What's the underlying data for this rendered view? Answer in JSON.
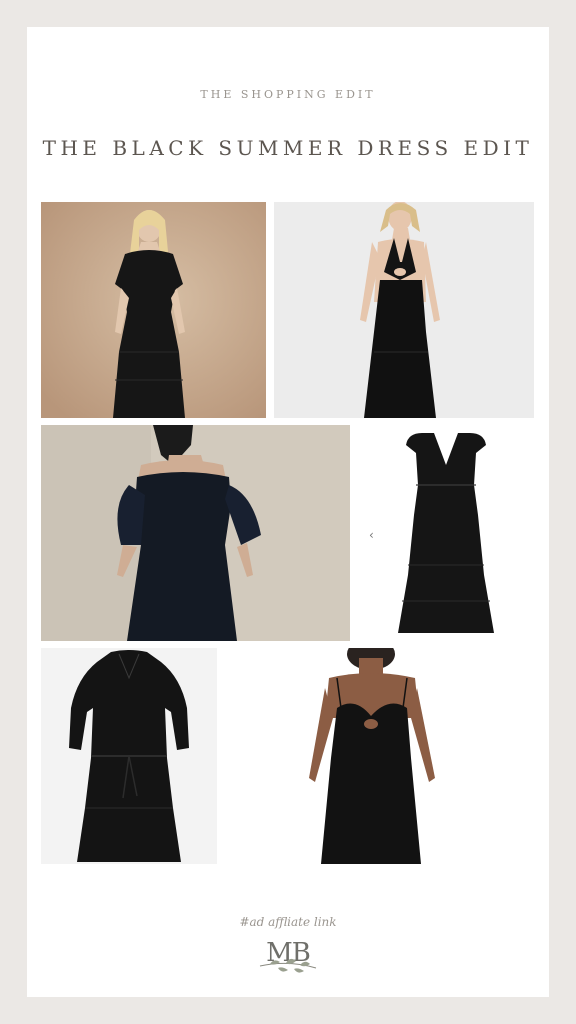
{
  "header": {
    "kicker": "THE SHOPPING EDIT",
    "title": "THE BLACK SUMMER DRESS EDIT"
  },
  "products": [
    {
      "name": "dress-tiered-short-sleeve",
      "background": "#c9ab8f"
    },
    {
      "name": "dress-halter-cutout-eyelet",
      "background": "#ececec"
    },
    {
      "name": "dress-off-shoulder-puff-sleeve",
      "background": "#d2cabd"
    },
    {
      "name": "dress-flutter-sleeve-tiered",
      "background": "#ffffff"
    },
    {
      "name": "dress-long-sleeve-belted",
      "background": "#f3f3f3"
    },
    {
      "name": "dress-cami-twist-front",
      "background": "#ffffff"
    }
  ],
  "carousel": {
    "prev_glyph": "‹"
  },
  "footer": {
    "tagline": "#ad affliate link",
    "logo_text": "MB"
  }
}
